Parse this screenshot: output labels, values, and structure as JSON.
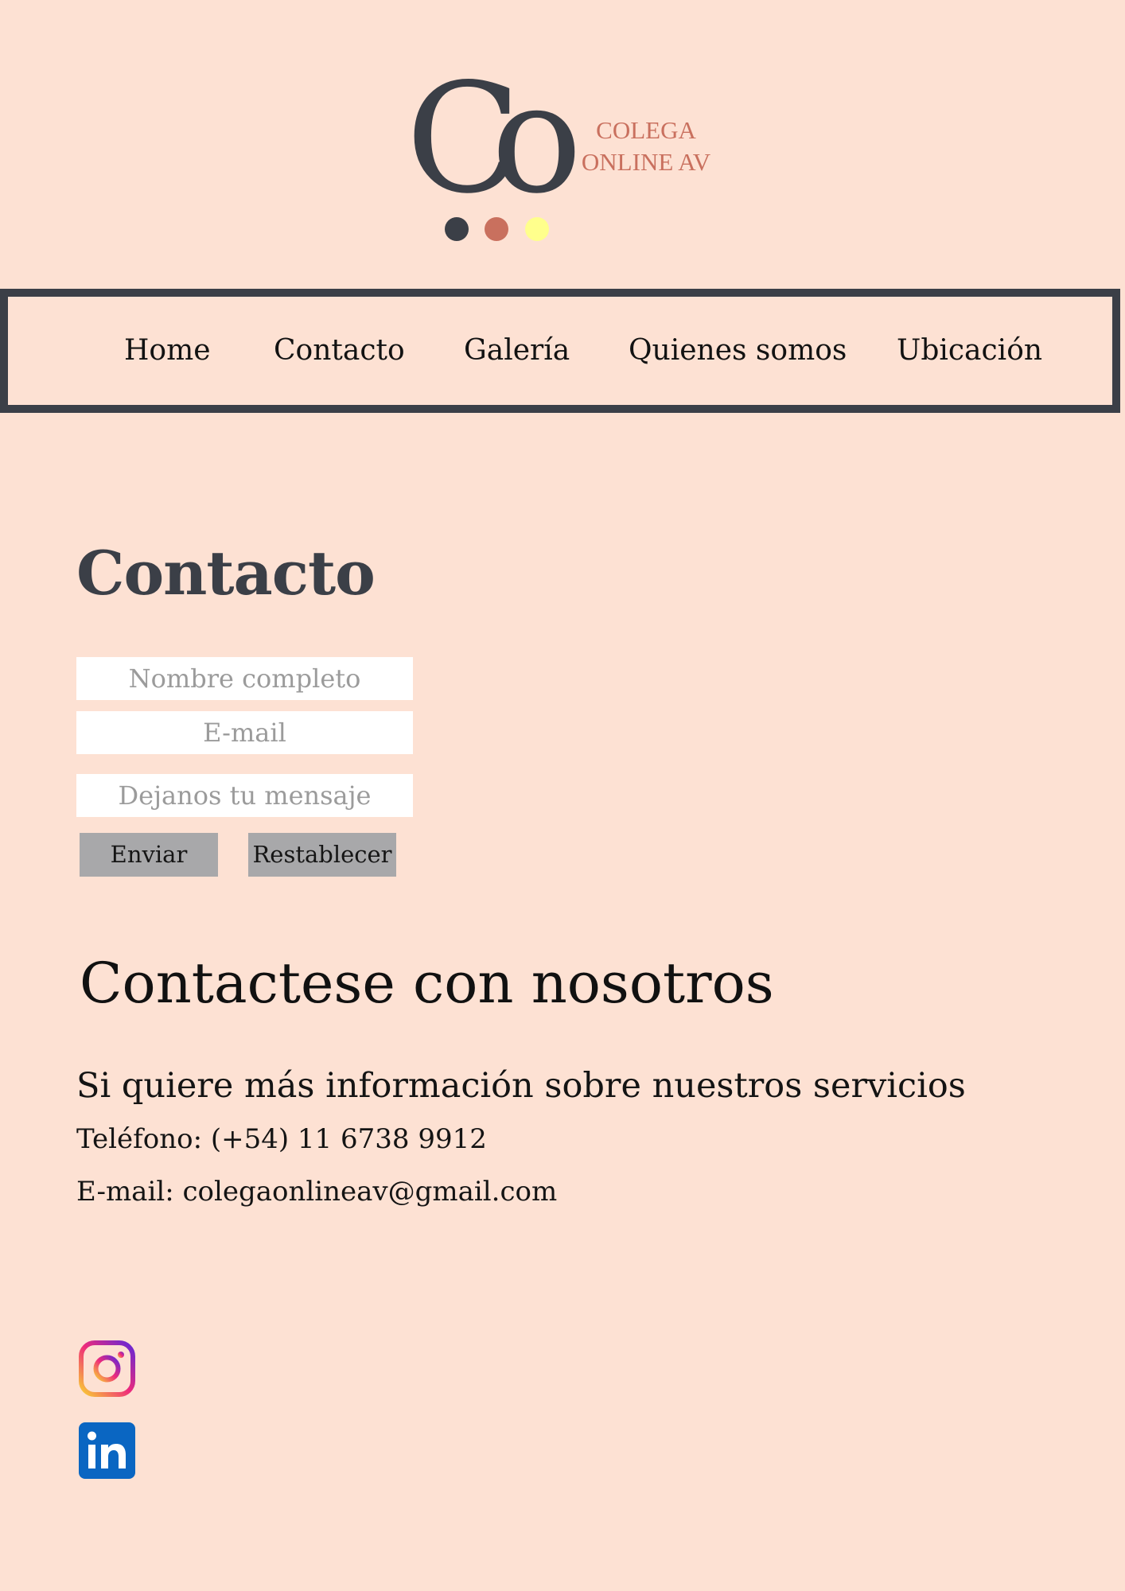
{
  "logo": {
    "monogram": "Co",
    "line1": "COLEGA",
    "line2": "ONLINE AV",
    "colors": {
      "dark": "#3b3f47",
      "accent": "#c9705e",
      "dot3": "#ffff8c"
    }
  },
  "nav": {
    "items": [
      {
        "label": "Home"
      },
      {
        "label": "Contacto"
      },
      {
        "label": "Galería"
      },
      {
        "label": "Quienes somos"
      },
      {
        "label": "Ubicación"
      }
    ]
  },
  "contact": {
    "title": "Contacto",
    "form": {
      "name_placeholder": "Nombre completo",
      "email_placeholder": "E-mail",
      "message_placeholder": "Dejanos tu mensaje",
      "submit_label": "Enviar",
      "reset_label": "Restablecer"
    }
  },
  "info": {
    "title": "Contactese con nosotros",
    "subtitle": "Si quiere más información sobre nuestros servicios",
    "phone": "Teléfono: (+54) 11 6738 9912",
    "email": "E-mail: colegaonlineav@gmail.com"
  },
  "social": {
    "icons": [
      "instagram-icon",
      "linkedin-icon"
    ]
  },
  "colors": {
    "background": "#fde1d3",
    "nav_border": "#3b3f47",
    "button": "#a8a8aa",
    "instagram_gradient": [
      "#f9ce34",
      "#ee2a7b",
      "#6228d7"
    ],
    "linkedin": "#0a66c2"
  }
}
